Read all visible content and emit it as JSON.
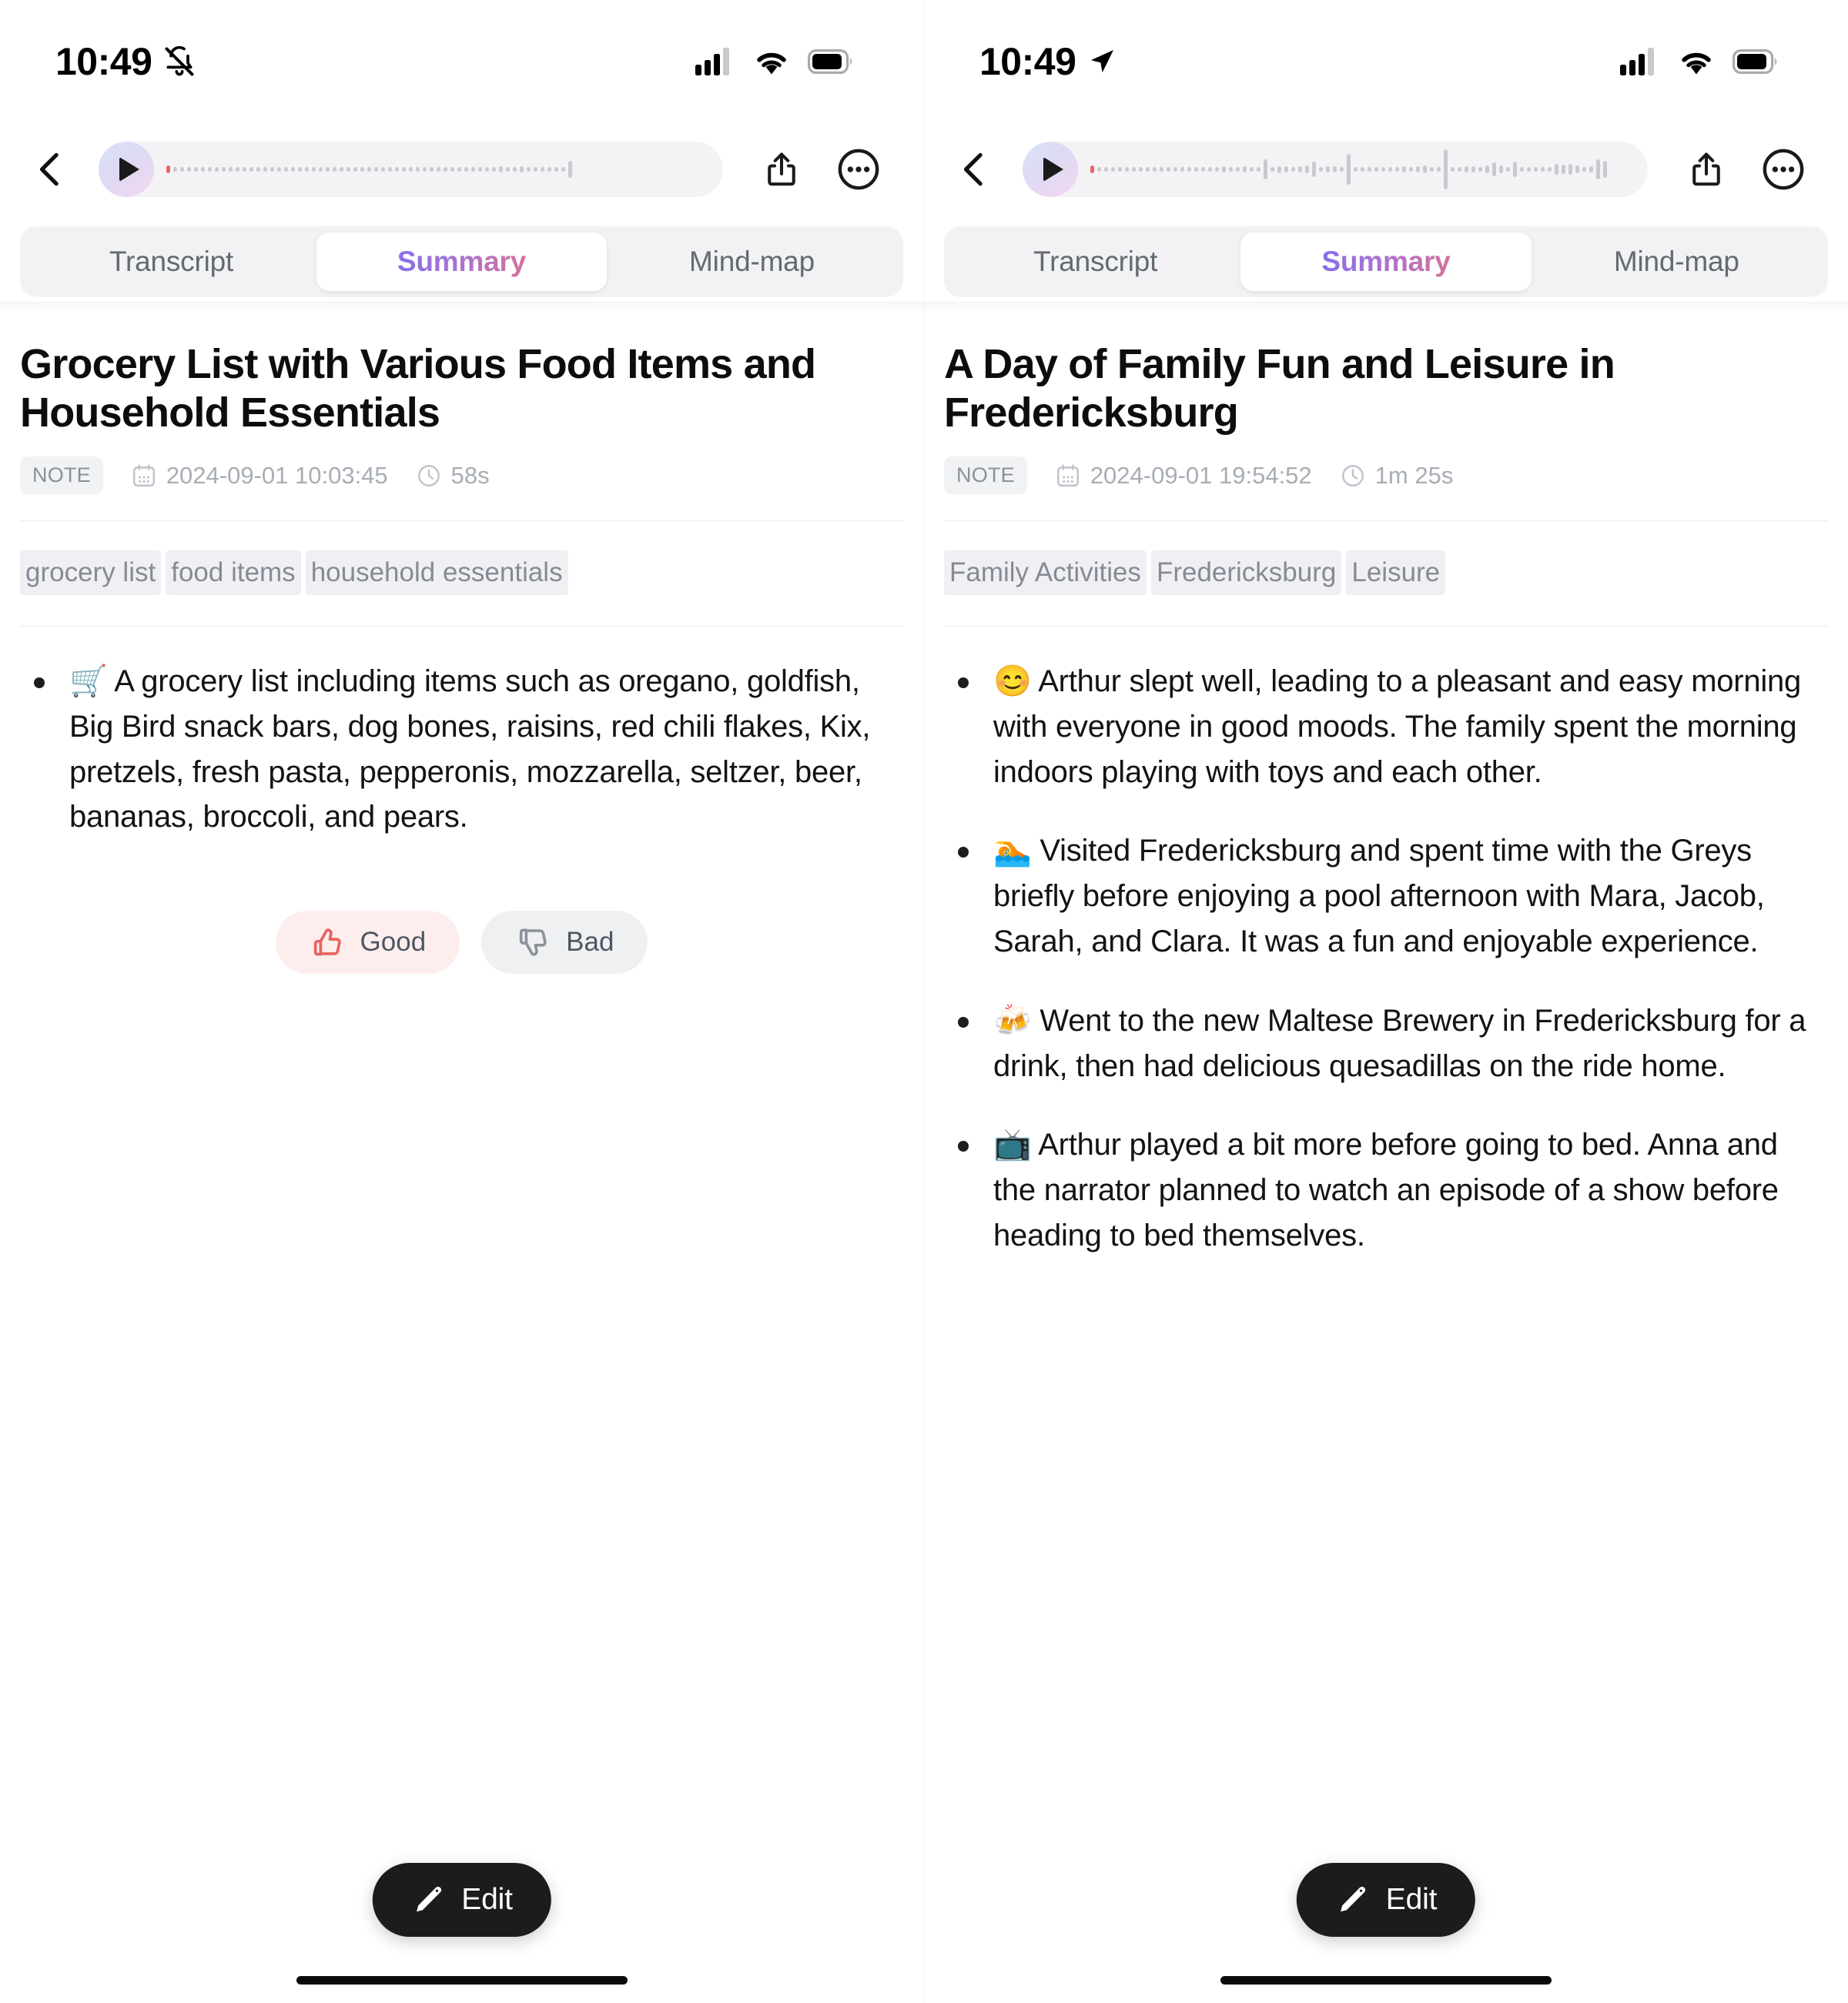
{
  "panels": [
    {
      "id": "left",
      "status_bar": {
        "time": "10:49",
        "left_icon": "bell-slash-icon",
        "icons": [
          "cellular-signal-icon",
          "wifi-icon",
          "battery-icon"
        ]
      },
      "nav": {
        "back_icon": "chevron-left-icon",
        "play_icon": "play-icon",
        "share_icon": "share-icon",
        "more_icon": "more-circle-icon",
        "waveform_heights": [
          10,
          6,
          6,
          6,
          6,
          6,
          6,
          6,
          6,
          6,
          6,
          6,
          6,
          6,
          6,
          6,
          6,
          6,
          6,
          6,
          6,
          6,
          6,
          6,
          6,
          6,
          6,
          6,
          6,
          6,
          6,
          6,
          6,
          6,
          6,
          6,
          6,
          6,
          6,
          6,
          6,
          6,
          6,
          6,
          6,
          6,
          6,
          6,
          8,
          6,
          6,
          8,
          6,
          6,
          6,
          6,
          6,
          6,
          22
        ]
      },
      "tabs": [
        {
          "label": "Transcript",
          "active": false
        },
        {
          "label": "Summary",
          "active": true
        },
        {
          "label": "Mind-map",
          "active": false
        }
      ],
      "note": {
        "title": "Grocery List with Various Food Items and Household Essentials",
        "badge": "NOTE",
        "date": "2024-09-01 10:03:45",
        "duration": "58s",
        "calendar_icon": "calendar-icon",
        "clock_icon": "clock-icon",
        "tags": [
          "grocery list",
          "food items",
          "household essentials"
        ],
        "bullets": [
          "🛒 A grocery list including items such as oregano, goldfish, Big Bird snack bars, dog bones, raisins, red chili flakes, Kix, pretzels, fresh pasta, pepperonis, mozzarella, seltzer, beer, bananas, broccoli, and pears."
        ]
      },
      "feedback": {
        "visible": true,
        "good_label": "Good",
        "bad_label": "Bad",
        "good_icon": "thumbs-up-icon",
        "bad_icon": "thumbs-down-icon",
        "good_color": "#e8635f",
        "bad_color": "#8d939c"
      },
      "edit_button": {
        "label": "Edit",
        "icon": "pencil-icon"
      }
    },
    {
      "id": "right",
      "status_bar": {
        "time": "10:49",
        "left_icon": "location-arrow-icon",
        "icons": [
          "cellular-signal-icon",
          "wifi-icon",
          "battery-icon"
        ]
      },
      "nav": {
        "back_icon": "chevron-left-icon",
        "play_icon": "play-icon",
        "share_icon": "share-icon",
        "more_icon": "more-circle-icon",
        "waveform_heights": [
          10,
          6,
          6,
          6,
          6,
          6,
          6,
          6,
          6,
          6,
          6,
          6,
          6,
          6,
          6,
          6,
          6,
          6,
          6,
          8,
          6,
          6,
          8,
          6,
          6,
          26,
          6,
          9,
          8,
          6,
          8,
          10,
          20,
          6,
          8,
          8,
          6,
          40,
          6,
          6,
          6,
          6,
          6,
          6,
          6,
          8,
          6,
          8,
          10,
          6,
          6,
          52,
          6,
          6,
          8,
          8,
          6,
          10,
          18,
          10,
          6,
          20,
          6,
          6,
          6,
          6,
          6,
          14,
          12,
          14,
          10,
          6,
          8,
          26,
          22
        ]
      },
      "tabs": [
        {
          "label": "Transcript",
          "active": false
        },
        {
          "label": "Summary",
          "active": true
        },
        {
          "label": "Mind-map",
          "active": false
        }
      ],
      "note": {
        "title": "A Day of Family Fun and Leisure in Fredericksburg",
        "badge": "NOTE",
        "date": "2024-09-01 19:54:52",
        "duration": "1m 25s",
        "calendar_icon": "calendar-icon",
        "clock_icon": "clock-icon",
        "tags": [
          "Family Activities",
          "Fredericksburg",
          "Leisure"
        ],
        "bullets": [
          "😊 Arthur slept well, leading to a pleasant and easy morning with everyone in good moods. The family spent the morning indoors playing with toys and each other.",
          "🏊 Visited Fredericksburg and spent time with the Greys briefly before enjoying a pool afternoon with Mara, Jacob, Sarah, and Clara. It was a fun and enjoyable experience.",
          "🍻 Went to the new Maltese Brewery in Fredericksburg for a drink, then had delicious quesadillas on the ride home.",
          "📺 Arthur played a bit more before going to bed. Anna and the narrator planned to watch an episode of a show before heading to bed themselves."
        ]
      },
      "feedback": {
        "visible": false
      },
      "edit_button": {
        "label": "Edit",
        "icon": "pencil-icon"
      }
    }
  ],
  "theme": {
    "accent_gradient_start": "#8b6ee8",
    "accent_gradient_end": "#d4729b",
    "fab_background": "#1c1c1e",
    "tag_background": "#f0f0f4",
    "tag_text": "#858b94",
    "meta_text": "#a7adb5"
  }
}
